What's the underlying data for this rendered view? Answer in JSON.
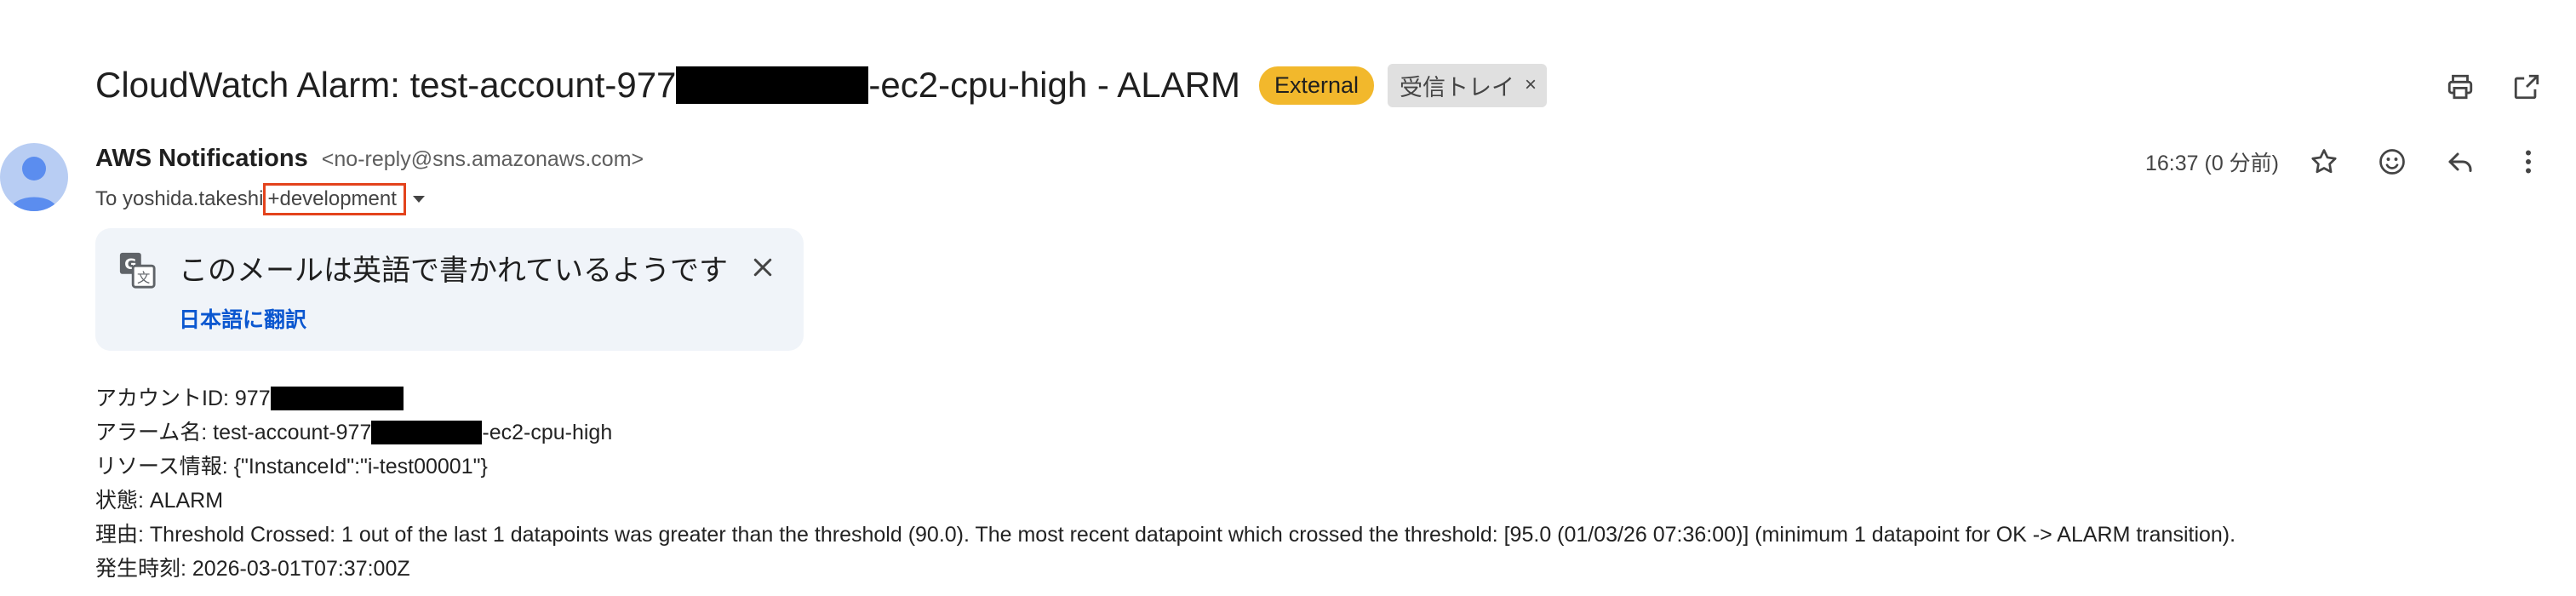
{
  "email": {
    "subject_prefix": "CloudWatch Alarm: test-account-977",
    "subject_suffix": "-ec2-cpu-high - ALARM",
    "labels": {
      "external": "External",
      "inbox": "受信トレイ",
      "inbox_remove": "×"
    },
    "sender": {
      "name": "AWS Notifications",
      "email": "<no-reply@sns.amazonaws.com>"
    },
    "to": {
      "prefix": "To yoshida.takeshi",
      "highlight": "+development"
    },
    "time": "16:37 (0 分前)"
  },
  "translate": {
    "message": "このメールは英語で書かれているようです",
    "link": "日本語に翻訳"
  },
  "body": {
    "account_label": "アカウントID: 977",
    "alarm_prefix": "アラーム名: test-account-977",
    "alarm_suffix": "-ec2-cpu-high",
    "resource": "リソース情報: {\"InstanceId\":\"i-test00001\"}",
    "state": "状態: ALARM",
    "reason": "理由: Threshold Crossed: 1 out of the last 1 datapoints was greater than the threshold (90.0). The most recent datapoint which crossed the threshold: [95.0 (01/03/26 07:36:00)] (minimum 1 datapoint for OK -> ALARM transition).",
    "occurred": "発生時刻: 2026-03-01T07:37:00Z"
  },
  "icons": {
    "print": "print-icon",
    "open_new_window": "open-in-new-window-icon",
    "star": "star-icon",
    "emoji": "emoji-icon",
    "reply": "reply-icon",
    "more": "more-vert-icon",
    "translate": "translate-icon",
    "close": "close-icon",
    "avatar": "avatar-icon",
    "caret": "caret-down-icon"
  },
  "colors": {
    "external_badge": "#f2b82c",
    "link": "#0b57d0",
    "highlight_border": "#e3431c",
    "translate_card": "#f0f4f9",
    "avatar_bg": "#b8cdf3"
  }
}
